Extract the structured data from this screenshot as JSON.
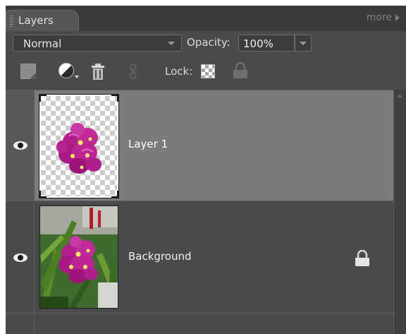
{
  "panel": {
    "tab_label": "Layers",
    "more_label": "more"
  },
  "controls": {
    "blend_mode": "Normal",
    "opacity_label": "Opacity:",
    "opacity_value": "100%",
    "lock_label": "Lock:"
  },
  "toolbar_icons": [
    "new-layer-icon",
    "adjustment-layer-icon",
    "trash-icon",
    "link-icon",
    "lock-transparent-icon",
    "lock-all-icon"
  ],
  "layers": [
    {
      "name": "Layer 1",
      "visible": true,
      "selected": true,
      "locked": false,
      "thumbnail": "orchid-on-transparent"
    },
    {
      "name": "Background",
      "visible": true,
      "selected": false,
      "locked": true,
      "thumbnail": "orchid-photo"
    }
  ],
  "colors": {
    "panel_bg": "#4a4a4a",
    "selected_row": "#7b7b7b",
    "header_bg": "#3b3b3b"
  }
}
